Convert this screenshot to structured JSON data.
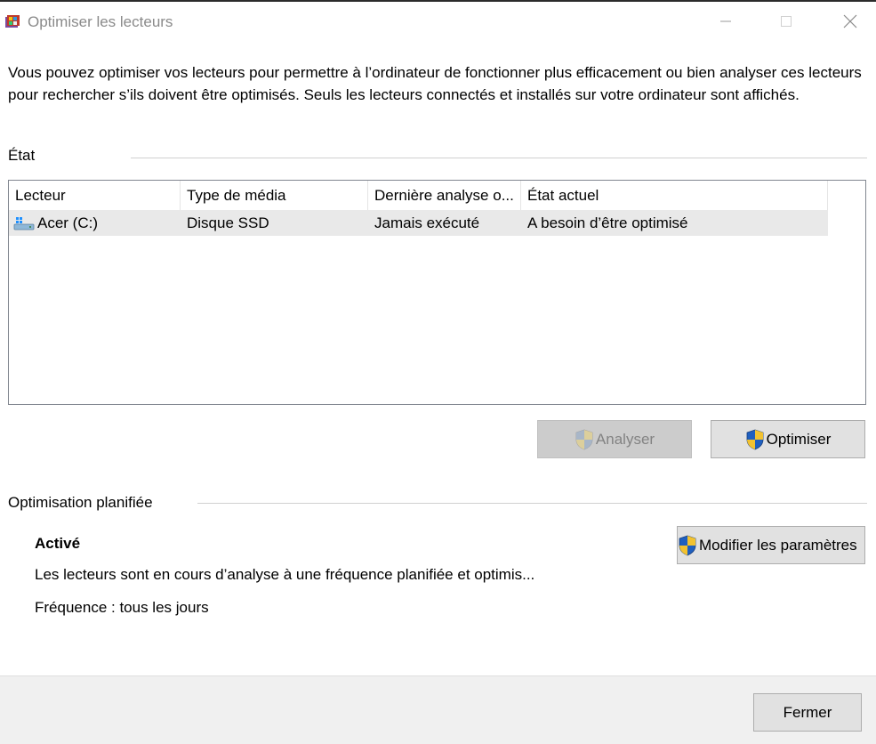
{
  "window": {
    "title": "Optimiser les lecteurs",
    "app_icon": "defrag-icon",
    "controls": [
      "minimize-icon",
      "maximize-icon",
      "close-icon"
    ]
  },
  "intro_text": "Vous pouvez optimiser vos lecteurs pour permettre à l’ordinateur de fonctionner plus efficacement ou bien analyser ces lecteurs pour rechercher s’ils doivent être optimisés. Seuls les lecteurs connectés et installés sur votre ordinateur sont affichés.",
  "status_section": {
    "label": "État",
    "columns": [
      "Lecteur",
      "Type de média",
      "Dernière analyse o...",
      "État actuel"
    ],
    "rows": [
      {
        "icon": "drive-icon",
        "drive": "Acer (C:)",
        "media_type": "Disque SSD",
        "last_analysis": "Jamais exécuté",
        "current_state": "A besoin d’être optimisé"
      }
    ]
  },
  "actions": {
    "analyze_label": "Analyser",
    "analyze_enabled": false,
    "optimize_label": "Optimiser"
  },
  "scheduled": {
    "label": "Optimisation planifiée",
    "status": "Activé",
    "description": "Les lecteurs sont en cours d’analyse à une fréquence planifiée et optimis...",
    "frequency": "Fréquence : tous les jours",
    "modify_label": "Modifier les paramètres"
  },
  "footer": {
    "close_label": "Fermer"
  },
  "colors": {
    "shield_blue": "#1f5fbf",
    "shield_yellow": "#f2c230",
    "selected_row": "#e9e9e9"
  }
}
